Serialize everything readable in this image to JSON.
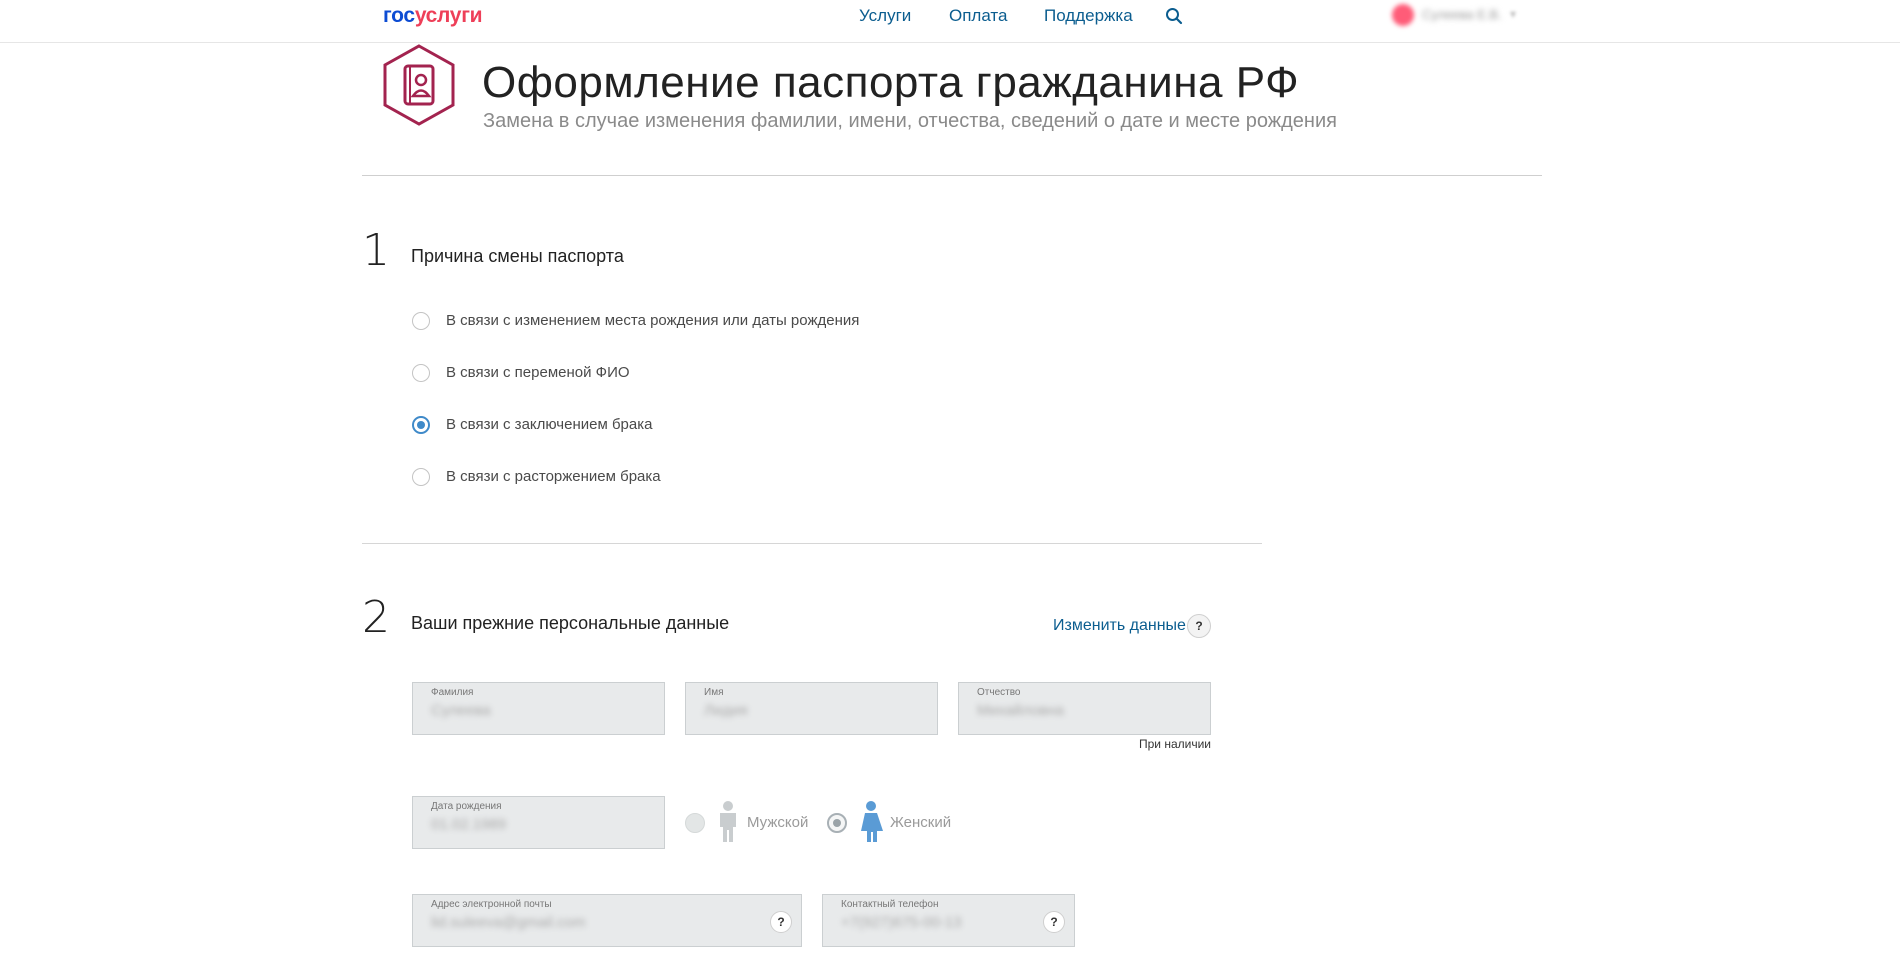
{
  "header": {
    "logo_part1": "гос",
    "logo_part2": "услуги",
    "nav": [
      "Услуги",
      "Оплата",
      "Поддержка"
    ],
    "user_name": "Сулеева Е.В."
  },
  "page": {
    "title": "Оформление паспорта гражданина РФ",
    "subtitle": "Замена в случае изменения фамилии, имени, отчества, сведений о дате и месте рождения"
  },
  "step1": {
    "number": "1",
    "title": "Причина смены паспорта",
    "options": [
      {
        "label": "В связи с изменением места рождения или даты рождения",
        "checked": false
      },
      {
        "label": "В связи с переменой ФИО",
        "checked": false
      },
      {
        "label": "В связи с заключением брака",
        "checked": true
      },
      {
        "label": "В связи с расторжением брака",
        "checked": false
      }
    ]
  },
  "step2": {
    "number": "2",
    "title": "Ваши прежние персональные данные",
    "change_link": "Изменить данные",
    "help": "?",
    "fields": {
      "surname": {
        "label": "Фамилия",
        "value": "Сулеева"
      },
      "name": {
        "label": "Имя",
        "value": "Лидия"
      },
      "patronymic": {
        "label": "Отчество",
        "value": "Михайловна",
        "note": "При наличии"
      },
      "birthdate": {
        "label": "Дата рождения",
        "value": "01.02.1989"
      },
      "email": {
        "label": "Адрес электронной почты",
        "value": "lid.suleeva@gmail.com"
      },
      "phone": {
        "label": "Контактный телефон",
        "value": "+7(927)675-00-13"
      }
    },
    "gender": {
      "male": "Мужской",
      "female": "Женский",
      "selected": "female"
    }
  },
  "colors": {
    "brand_blue": "#0d4cd3",
    "brand_red": "#ee3f58",
    "link": "#0b5d8f",
    "icon_magenta": "#a3234f",
    "radio_active": "#3f8ac9",
    "female_icon": "#5a9bd5",
    "male_icon": "#c9cdcf"
  }
}
